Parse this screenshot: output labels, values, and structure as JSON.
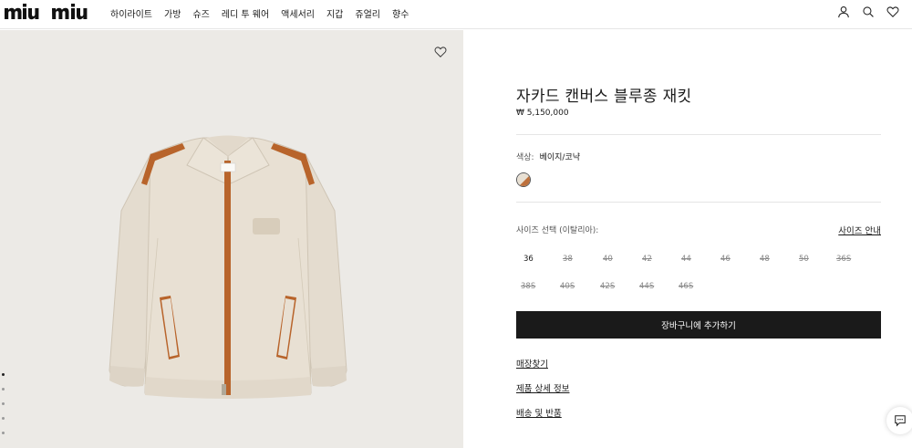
{
  "header": {
    "logo_text": "MIU MIU",
    "nav": [
      "하이라이트",
      "가방",
      "슈즈",
      "레디 투 웨어",
      "액세서리",
      "지갑",
      "쥬얼리",
      "향수"
    ]
  },
  "product": {
    "title": "자카드 캔버스 블루종 재킷",
    "price": "₩ 5,150,000",
    "color_label": "색상:",
    "color_value": "베이지/코냑",
    "size_label": "사이즈 선택 (이탈리아):",
    "size_guide": "사이즈 안내",
    "sizes_row1": [
      {
        "label": "36",
        "available": true
      },
      {
        "label": "38",
        "available": false
      },
      {
        "label": "40",
        "available": false
      },
      {
        "label": "42",
        "available": false
      },
      {
        "label": "44",
        "available": false
      },
      {
        "label": "46",
        "available": false
      },
      {
        "label": "48",
        "available": false
      },
      {
        "label": "50",
        "available": false
      },
      {
        "label": "36S",
        "available": false
      }
    ],
    "sizes_row2": [
      {
        "label": "38S",
        "available": false
      },
      {
        "label": "40S",
        "available": false
      },
      {
        "label": "42S",
        "available": false
      },
      {
        "label": "44S",
        "available": false
      },
      {
        "label": "46S",
        "available": false
      }
    ],
    "add_to_cart": "장바구니에 추가하기",
    "links": [
      "매장찾기",
      "제품 상세 정보",
      "배송 및 반품"
    ]
  },
  "gallery": {
    "image_count": 5,
    "active_index": 0
  },
  "colors": {
    "accent": "#1a1a1a",
    "jacket_body": "#e8e0d3",
    "trim": "#b8642b"
  },
  "icons": [
    "account-icon",
    "search-icon",
    "wishlist-icon",
    "heart-icon",
    "chat-icon"
  ]
}
